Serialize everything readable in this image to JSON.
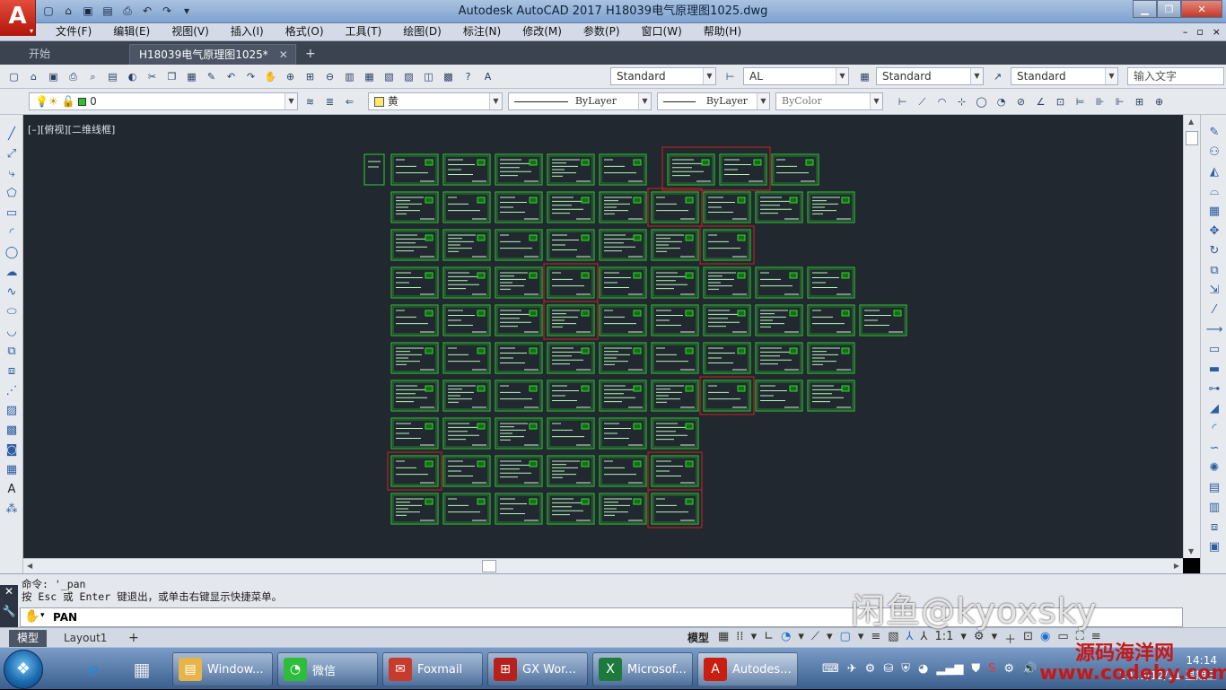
{
  "app": {
    "logo_letter": "A",
    "title": "Autodesk AutoCAD 2017    H18039电气原理图1025.dwg"
  },
  "qat_icons": [
    "new-icon",
    "open-icon",
    "save-icon",
    "saveas-icon",
    "print-icon",
    "undo-icon",
    "redo-icon"
  ],
  "menus": [
    "文件(F)",
    "编辑(E)",
    "视图(V)",
    "插入(I)",
    "格式(O)",
    "工具(T)",
    "绘图(D)",
    "标注(N)",
    "修改(M)",
    "参数(P)",
    "窗口(W)",
    "帮助(H)"
  ],
  "mdi_controls": [
    "–",
    "▫",
    "×"
  ],
  "tabs": {
    "start": "开始",
    "doc": "H18039电气原理图1025*",
    "add": "+"
  },
  "toolbar1": {
    "text_style": "Standard",
    "dim_style": "AL",
    "table_style": "Standard",
    "multileader_style": "Standard",
    "input_placeholder": "输入文字"
  },
  "toolbar2": {
    "layer": "0",
    "color": "黄",
    "linetype": "ByLayer",
    "lineweight": "ByLayer",
    "plotstyle": "ByColor"
  },
  "viewport": {
    "label": "[–][俯视][二维线框]"
  },
  "command": {
    "line1": "命令: '_pan",
    "line2": "按 Esc 或 Enter 键退出，或单击右键显示快捷菜单。",
    "input": "PAN"
  },
  "status": {
    "model_tab": "模型",
    "layout_tab": "Layout1",
    "add_tab": "+",
    "model_button": "模型",
    "scale": "1:1"
  },
  "taskbar": {
    "tasks": [
      {
        "label": "Window...",
        "icon": "explorer-icon",
        "color": "#e7b547"
      },
      {
        "label": "微信",
        "icon": "wechat-icon",
        "color": "#2dbd3a"
      },
      {
        "label": "Foxmail",
        "icon": "foxmail-icon",
        "color": "#c63b2c"
      },
      {
        "label": "GX Wor...",
        "icon": "gxworks-icon",
        "color": "#b6211b"
      },
      {
        "label": "Microsof...",
        "icon": "excel-icon",
        "color": "#1d7a3c"
      },
      {
        "label": "Autodes...",
        "icon": "autocad-icon",
        "color": "#c81f10"
      }
    ],
    "clock_time": "14:14",
    "clock_date": "2019/12/11 星期三"
  },
  "watermark": {
    "line1": "闲鱼@kyoxsky",
    "line2": "源码海洋网",
    "line3": "www.codehy.com"
  },
  "colors": {
    "canvas": "#212830",
    "sheet": "#2fd12f",
    "highlight": "#d01f1f",
    "accent": "#c81f10"
  },
  "drawing_grid": {
    "rows": [
      {
        "count": 5,
        "first": 0
      },
      {
        "count": 9,
        "first": 0
      },
      {
        "count": 7,
        "first": 0
      },
      {
        "count": 9,
        "first": 0
      },
      {
        "count": 10,
        "first": 0
      },
      {
        "count": 9,
        "first": 0
      },
      {
        "count": 9,
        "first": 0
      },
      {
        "count": 6,
        "first": 0
      },
      {
        "count": 6,
        "first": 0
      },
      {
        "count": 6,
        "first": 0
      }
    ],
    "extra_row1_right": 3
  }
}
